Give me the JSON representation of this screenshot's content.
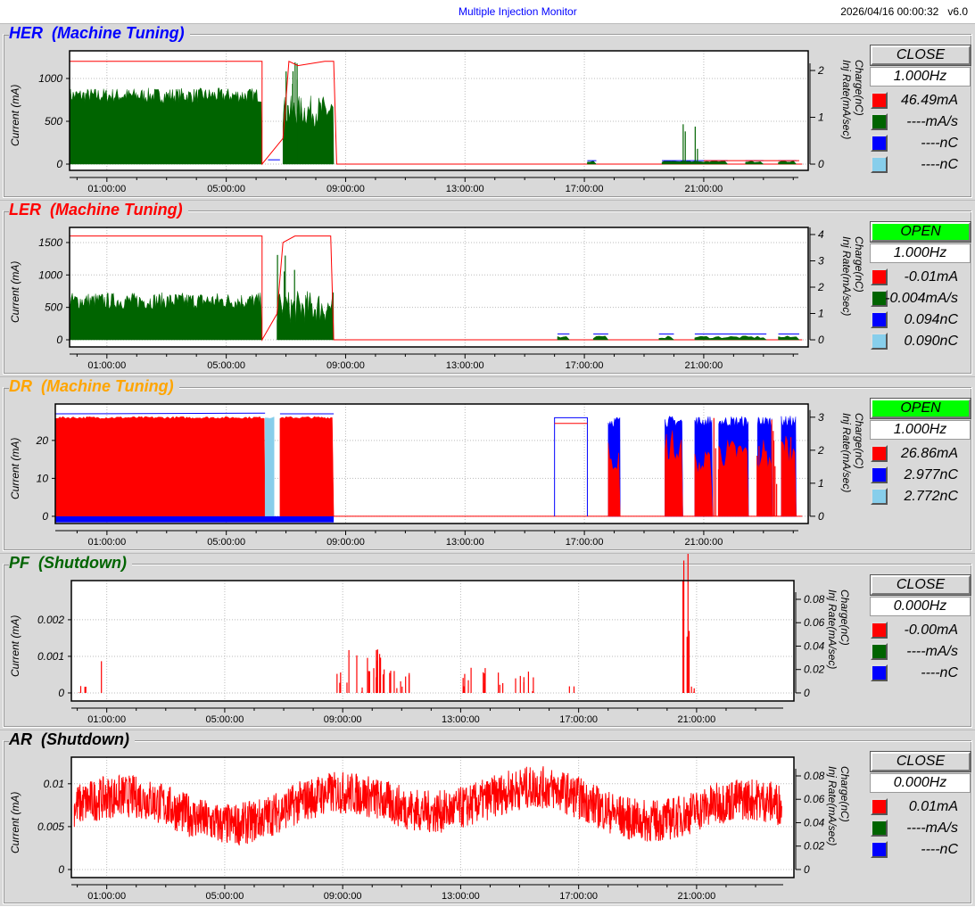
{
  "header": {
    "title": "Multiple Injection Monitor",
    "datetime": "2026/04/16 00:00:32",
    "version": "v6.0"
  },
  "time_ticks": [
    "01:00:00",
    "05:00:00",
    "09:00:00",
    "13:00:00",
    "17:00:00",
    "21:00:00"
  ],
  "y_label": "Current (mA)",
  "right_label_1": "Charge(nC)",
  "right_label_2": "Inj Rate(mA/sec)",
  "panels": [
    {
      "id": "her",
      "name": "HER",
      "status": "(Machine Tuning)",
      "title_color": "#0000ff",
      "button": "CLOSE",
      "button_color": "#d9d9d9",
      "freq": "1.000Hz",
      "left_ticks": [
        "0",
        "500",
        "1000"
      ],
      "left_vals": [
        0,
        500,
        1000
      ],
      "right_ticks": [
        "0",
        "1",
        "2"
      ],
      "right_vals": [
        0,
        1,
        2
      ],
      "legend": [
        {
          "color": "#ff0000",
          "value": "46.49mA"
        },
        {
          "color": "#006400",
          "value": "----mA/s"
        },
        {
          "color": "#0000ff",
          "value": "----nC"
        },
        {
          "color": "#87ceeb",
          "value": "----nC"
        }
      ]
    },
    {
      "id": "ler",
      "name": "LER",
      "status": "(Machine Tuning)",
      "title_color": "#ff0000",
      "button": "OPEN",
      "button_color": "#00ff00",
      "freq": "1.000Hz",
      "left_ticks": [
        "0",
        "500",
        "1000",
        "1500"
      ],
      "left_vals": [
        0,
        500,
        1000,
        1500
      ],
      "right_ticks": [
        "0",
        "1",
        "2",
        "3",
        "4"
      ],
      "right_vals": [
        0,
        1,
        2,
        3,
        4
      ],
      "legend": [
        {
          "color": "#ff0000",
          "value": "-0.01mA"
        },
        {
          "color": "#006400",
          "value": "-0.004mA/s"
        },
        {
          "color": "#0000ff",
          "value": "0.094nC"
        },
        {
          "color": "#87ceeb",
          "value": "0.090nC"
        }
      ]
    },
    {
      "id": "dr",
      "name": "DR",
      "status": "(Machine Tuning)",
      "title_color": "#ffa500",
      "button": "OPEN",
      "button_color": "#00ff00",
      "freq": "1.000Hz",
      "left_ticks": [
        "0",
        "10",
        "20"
      ],
      "left_vals": [
        0,
        10,
        20
      ],
      "right_ticks": [
        "0",
        "1",
        "2",
        "3"
      ],
      "right_vals": [
        0,
        1,
        2,
        3
      ],
      "legend": [
        {
          "color": "#ff0000",
          "value": "26.86mA"
        },
        {
          "color": "#0000ff",
          "value": "2.977nC"
        },
        {
          "color": "#87ceeb",
          "value": "2.772nC"
        }
      ]
    },
    {
      "id": "pf",
      "name": "PF",
      "status": "(Shutdown)",
      "title_color": "#006400",
      "button": "CLOSE",
      "button_color": "#d9d9d9",
      "freq": "0.000Hz",
      "left_ticks": [
        "0",
        "0.001",
        "0.002"
      ],
      "left_vals": [
        0,
        0.001,
        0.002
      ],
      "right_ticks": [
        "0",
        "0.02",
        "0.04",
        "0.06",
        "0.08"
      ],
      "right_vals": [
        0,
        0.02,
        0.04,
        0.06,
        0.08
      ],
      "legend": [
        {
          "color": "#ff0000",
          "value": "-0.00mA"
        },
        {
          "color": "#006400",
          "value": "----mA/s"
        },
        {
          "color": "#0000ff",
          "value": "----nC"
        }
      ]
    },
    {
      "id": "ar",
      "name": "AR",
      "status": "(Shutdown)",
      "title_color": "#000000",
      "button": "CLOSE",
      "button_color": "#d9d9d9",
      "freq": "0.000Hz",
      "left_ticks": [
        "0",
        "0.005",
        "0.01"
      ],
      "left_vals": [
        0,
        0.005,
        0.01
      ],
      "right_ticks": [
        "0",
        "0.02",
        "0.04",
        "0.06",
        "0.08"
      ],
      "right_vals": [
        0,
        0.02,
        0.04,
        0.06,
        0.08
      ],
      "legend": [
        {
          "color": "#ff0000",
          "value": "0.01mA"
        },
        {
          "color": "#006400",
          "value": "----mA/s"
        },
        {
          "color": "#0000ff",
          "value": "----nC"
        }
      ]
    }
  ]
}
